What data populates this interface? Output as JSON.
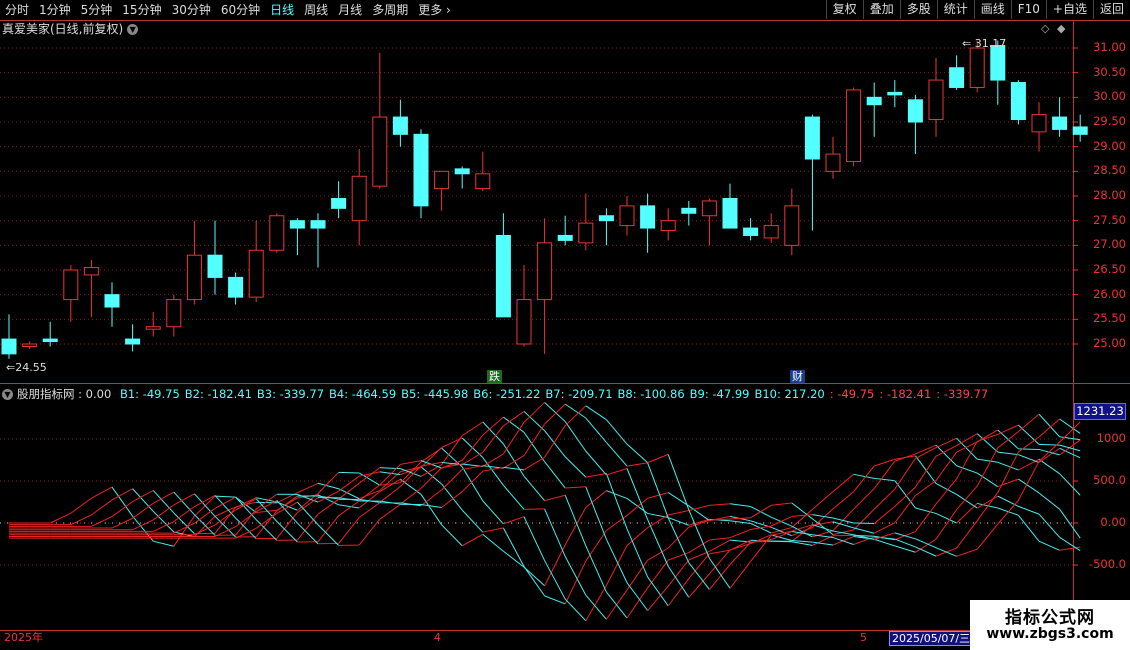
{
  "toolbar": {
    "periods": [
      {
        "label": "分时",
        "active": false
      },
      {
        "label": "1分钟",
        "active": false
      },
      {
        "label": "5分钟",
        "active": false
      },
      {
        "label": "15分钟",
        "active": false
      },
      {
        "label": "30分钟",
        "active": false
      },
      {
        "label": "60分钟",
        "active": false
      },
      {
        "label": "日线",
        "active": true
      },
      {
        "label": "周线",
        "active": false
      },
      {
        "label": "月线",
        "active": false
      },
      {
        "label": "多周期",
        "active": false
      },
      {
        "label": "更多",
        "active": false
      }
    ],
    "more_icon": "chevron-right-icon",
    "right_buttons": [
      "复权",
      "叠加",
      "多股",
      "统计",
      "画线",
      "F10",
      "+自选",
      "返回"
    ]
  },
  "stock": {
    "title": "真爱美家(日线,前复权)",
    "dropdown_icon": "chevron-down-icon"
  },
  "price_axis": {
    "labels": [
      "31.00",
      "30.50",
      "30.00",
      "29.50",
      "29.00",
      "28.50",
      "28.00",
      "27.50",
      "27.00",
      "26.50",
      "26.00",
      "25.50",
      "25.00"
    ],
    "high_label": "31.17",
    "low_label": "24.55"
  },
  "markers": {
    "die": "跌",
    "cai": "财"
  },
  "indicator": {
    "name": "股朋指标网 : 0.00",
    "values": [
      {
        "text": "B1: -49.75",
        "color": "#5ff"
      },
      {
        "text": "B2: -182.41",
        "color": "#5ff"
      },
      {
        "text": "B3: -339.77",
        "color": "#5ff"
      },
      {
        "text": "B4: -464.59",
        "color": "#5ff"
      },
      {
        "text": "B5: -445.98",
        "color": "#5ff"
      },
      {
        "text": "B6: -251.22",
        "color": "#5ff"
      },
      {
        "text": "B7: -209.71",
        "color": "#5ff"
      },
      {
        "text": "B8: -100.86",
        "color": "#5ff"
      },
      {
        "text": "B9: -47.99",
        "color": "#5ff"
      },
      {
        "text": "B10: 217.20",
        "color": "#5ff"
      },
      {
        "text": ": -49.75",
        "color": "#f44"
      },
      {
        "text": ": -182.41",
        "color": "#f44"
      },
      {
        "text": ": -339.77",
        "color": "#f44"
      }
    ],
    "axis_labels": [
      "1000",
      "500.0",
      "0.00",
      "-500.0"
    ],
    "current_value": "1231.23"
  },
  "timeline": {
    "year": "2025年",
    "month4": "4",
    "month5": "5",
    "selected_date": "2025/05/07/三"
  },
  "watermark": {
    "line1": "指标公式网",
    "line2": "www.zbgs3.com"
  },
  "colors": {
    "up": "#ee3333",
    "down": "#54ffff",
    "grid": "#8a1a1a"
  },
  "chart_data": {
    "type": "candlestick",
    "y_range": [
      24.55,
      31.17
    ],
    "candles": [
      {
        "o": 25.1,
        "h": 25.6,
        "l": 24.7,
        "c": 24.8
      },
      {
        "o": 24.95,
        "h": 25.05,
        "l": 24.9,
        "c": 25.0
      },
      {
        "o": 25.1,
        "h": 25.45,
        "l": 24.95,
        "c": 25.05
      },
      {
        "o": 25.9,
        "h": 26.6,
        "l": 25.45,
        "c": 26.5
      },
      {
        "o": 26.4,
        "h": 26.7,
        "l": 25.55,
        "c": 26.55
      },
      {
        "o": 26.0,
        "h": 26.25,
        "l": 25.35,
        "c": 25.75
      },
      {
        "o": 25.1,
        "h": 25.4,
        "l": 24.85,
        "c": 25.0
      },
      {
        "o": 25.3,
        "h": 25.65,
        "l": 25.15,
        "c": 25.35
      },
      {
        "o": 25.35,
        "h": 26.0,
        "l": 25.15,
        "c": 25.9
      },
      {
        "o": 25.9,
        "h": 27.5,
        "l": 25.8,
        "c": 26.8
      },
      {
        "o": 26.8,
        "h": 27.5,
        "l": 26.0,
        "c": 26.35
      },
      {
        "o": 26.35,
        "h": 26.45,
        "l": 25.8,
        "c": 25.95
      },
      {
        "o": 25.95,
        "h": 27.5,
        "l": 25.85,
        "c": 26.9
      },
      {
        "o": 26.9,
        "h": 27.65,
        "l": 26.85,
        "c": 27.6
      },
      {
        "o": 27.5,
        "h": 27.55,
        "l": 26.8,
        "c": 27.35
      },
      {
        "o": 27.5,
        "h": 27.65,
        "l": 26.55,
        "c": 27.35
      },
      {
        "o": 27.95,
        "h": 28.3,
        "l": 27.55,
        "c": 27.75
      },
      {
        "o": 27.5,
        "h": 28.95,
        "l": 27.0,
        "c": 28.4
      },
      {
        "o": 28.2,
        "h": 30.9,
        "l": 28.15,
        "c": 29.6
      },
      {
        "o": 29.6,
        "h": 29.95,
        "l": 29.0,
        "c": 29.25
      },
      {
        "o": 29.25,
        "h": 29.35,
        "l": 27.55,
        "c": 27.8
      },
      {
        "o": 28.15,
        "h": 28.5,
        "l": 27.7,
        "c": 28.5
      },
      {
        "o": 28.55,
        "h": 28.6,
        "l": 28.15,
        "c": 28.45
      },
      {
        "o": 28.15,
        "h": 28.9,
        "l": 28.1,
        "c": 28.45
      },
      {
        "o": 27.2,
        "h": 27.65,
        "l": 25.7,
        "c": 25.55
      },
      {
        "o": 25.0,
        "h": 26.6,
        "l": 24.95,
        "c": 25.9
      },
      {
        "o": 25.9,
        "h": 27.55,
        "l": 24.8,
        "c": 27.05
      },
      {
        "o": 27.2,
        "h": 27.6,
        "l": 27.0,
        "c": 27.1
      },
      {
        "o": 27.05,
        "h": 28.05,
        "l": 26.9,
        "c": 27.45
      },
      {
        "o": 27.6,
        "h": 27.75,
        "l": 27.0,
        "c": 27.5
      },
      {
        "o": 27.4,
        "h": 28.0,
        "l": 27.2,
        "c": 27.8
      },
      {
        "o": 27.8,
        "h": 28.05,
        "l": 26.85,
        "c": 27.35
      },
      {
        "o": 27.3,
        "h": 27.75,
        "l": 27.1,
        "c": 27.5
      },
      {
        "o": 27.75,
        "h": 27.9,
        "l": 27.4,
        "c": 27.65
      },
      {
        "o": 27.6,
        "h": 27.95,
        "l": 27.0,
        "c": 27.9
      },
      {
        "o": 27.95,
        "h": 28.25,
        "l": 27.35,
        "c": 27.35
      },
      {
        "o": 27.35,
        "h": 27.55,
        "l": 27.1,
        "c": 27.2
      },
      {
        "o": 27.15,
        "h": 27.65,
        "l": 27.05,
        "c": 27.4
      },
      {
        "o": 27.0,
        "h": 28.15,
        "l": 26.8,
        "c": 27.8
      },
      {
        "o": 29.6,
        "h": 29.65,
        "l": 27.3,
        "c": 28.75
      },
      {
        "o": 28.5,
        "h": 29.2,
        "l": 28.35,
        "c": 28.85
      },
      {
        "o": 28.7,
        "h": 30.2,
        "l": 28.6,
        "c": 30.15
      },
      {
        "o": 30.0,
        "h": 30.3,
        "l": 29.2,
        "c": 29.85
      },
      {
        "o": 30.1,
        "h": 30.35,
        "l": 29.8,
        "c": 30.05
      },
      {
        "o": 29.95,
        "h": 30.05,
        "l": 28.85,
        "c": 29.5
      },
      {
        "o": 29.55,
        "h": 30.8,
        "l": 29.2,
        "c": 30.35
      },
      {
        "o": 30.6,
        "h": 30.85,
        "l": 30.15,
        "c": 30.2
      },
      {
        "o": 30.2,
        "h": 31.15,
        "l": 30.1,
        "c": 31.0
      },
      {
        "o": 31.05,
        "h": 31.15,
        "l": 29.85,
        "c": 30.35
      },
      {
        "o": 30.3,
        "h": 30.35,
        "l": 29.45,
        "c": 29.55
      },
      {
        "o": 29.3,
        "h": 29.9,
        "l": 28.9,
        "c": 29.65
      },
      {
        "o": 29.6,
        "h": 30.0,
        "l": 29.2,
        "c": 29.35
      },
      {
        "o": 29.4,
        "h": 29.65,
        "l": 29.1,
        "c": 29.25
      }
    ]
  }
}
